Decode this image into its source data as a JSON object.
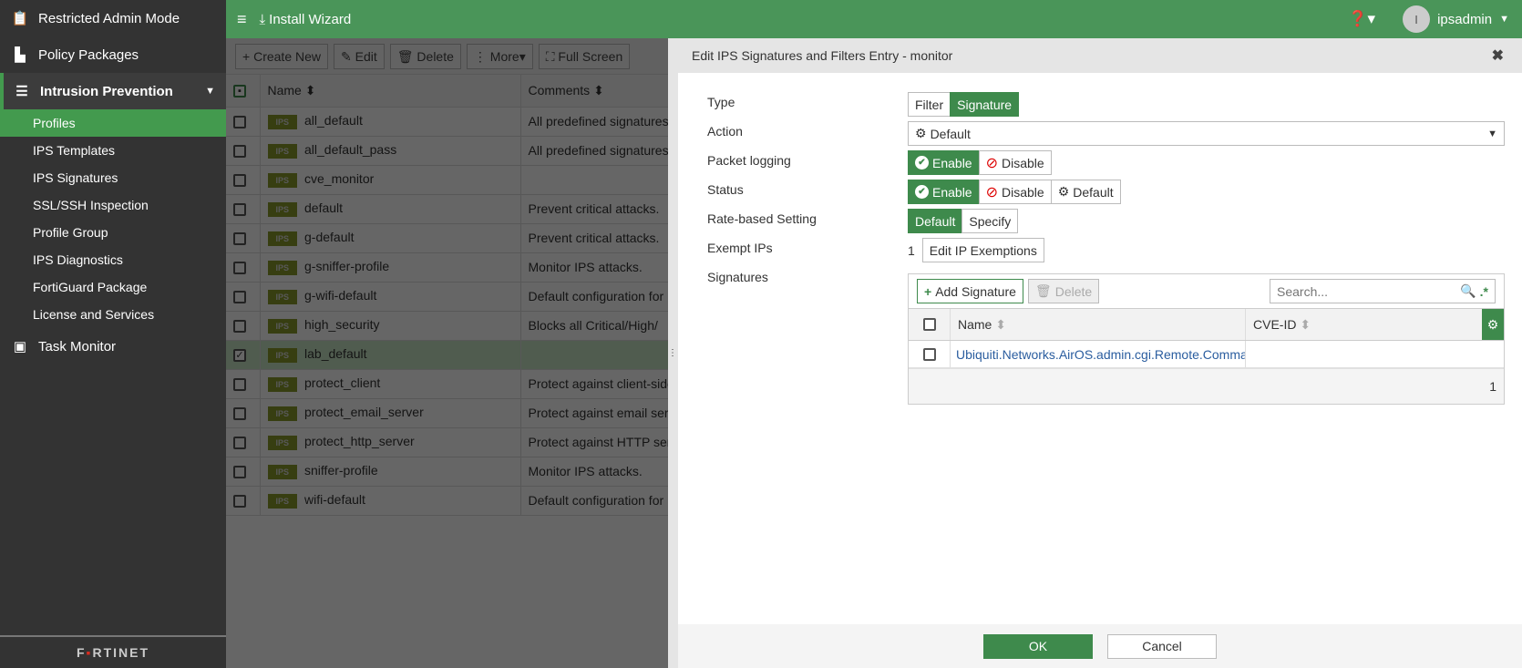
{
  "sidebar": {
    "top": "Restricted Admin Mode",
    "policy": "Policy Packages",
    "ips": "Intrusion Prevention",
    "items": [
      "Profiles",
      "IPS Templates",
      "IPS Signatures",
      "SSL/SSH Inspection",
      "Profile Group",
      "IPS Diagnostics",
      "FortiGuard Package",
      "License and Services"
    ],
    "task": "Task Monitor",
    "logo": "FORTINET"
  },
  "topbar": {
    "install": "Install Wizard",
    "avatar": "I",
    "user": "ipsadmin"
  },
  "toolbar": {
    "create": "Create New",
    "edit": "Edit",
    "delete": "Delete",
    "more": "More",
    "full": "Full Screen"
  },
  "table": {
    "headers": [
      "Name",
      "Comments"
    ],
    "badge": "IPS",
    "rows": [
      [
        "all_default",
        "All predefined signatures"
      ],
      [
        "all_default_pass",
        "All predefined signatures"
      ],
      [
        "cve_monitor",
        ""
      ],
      [
        "default",
        "Prevent critical attacks."
      ],
      [
        "g-default",
        "Prevent critical attacks."
      ],
      [
        "g-sniffer-profile",
        "Monitor IPS attacks."
      ],
      [
        "g-wifi-default",
        "Default configuration for"
      ],
      [
        "high_security",
        "Blocks all Critical/High/"
      ],
      [
        "lab_default",
        ""
      ],
      [
        "protect_client",
        "Protect against client-side"
      ],
      [
        "protect_email_server",
        "Protect against email servers"
      ],
      [
        "protect_http_server",
        "Protect against HTTP servers"
      ],
      [
        "sniffer-profile",
        "Monitor IPS attacks."
      ],
      [
        "wifi-default",
        "Default configuration for"
      ]
    ],
    "selected": 8
  },
  "dialog": {
    "title": "Edit IPS Signatures and Filters Entry - monitor",
    "labels": {
      "type": "Type",
      "action": "Action",
      "packet": "Packet logging",
      "status": "Status",
      "rate": "Rate-based Setting",
      "exempt": "Exempt IPs",
      "sigs": "Signatures"
    },
    "type_opts": [
      "Filter",
      "Signature"
    ],
    "action_value": "Default",
    "enable": "Enable",
    "disable": "Disable",
    "default": "Default",
    "specify": "Specify",
    "exempt_count": "1",
    "exempt_btn": "Edit IP Exemptions",
    "add_sig": "Add Signature",
    "del_sig": "Delete",
    "search_ph": "Search...",
    "cols": [
      "Name",
      "CVE-ID"
    ],
    "sig_rows": [
      {
        "name": "Ubiquiti.Networks.AirOS.admin.cgi.Remote.Command.Execution",
        "cve": ""
      }
    ],
    "count": "1",
    "ok": "OK",
    "cancel": "Cancel"
  }
}
